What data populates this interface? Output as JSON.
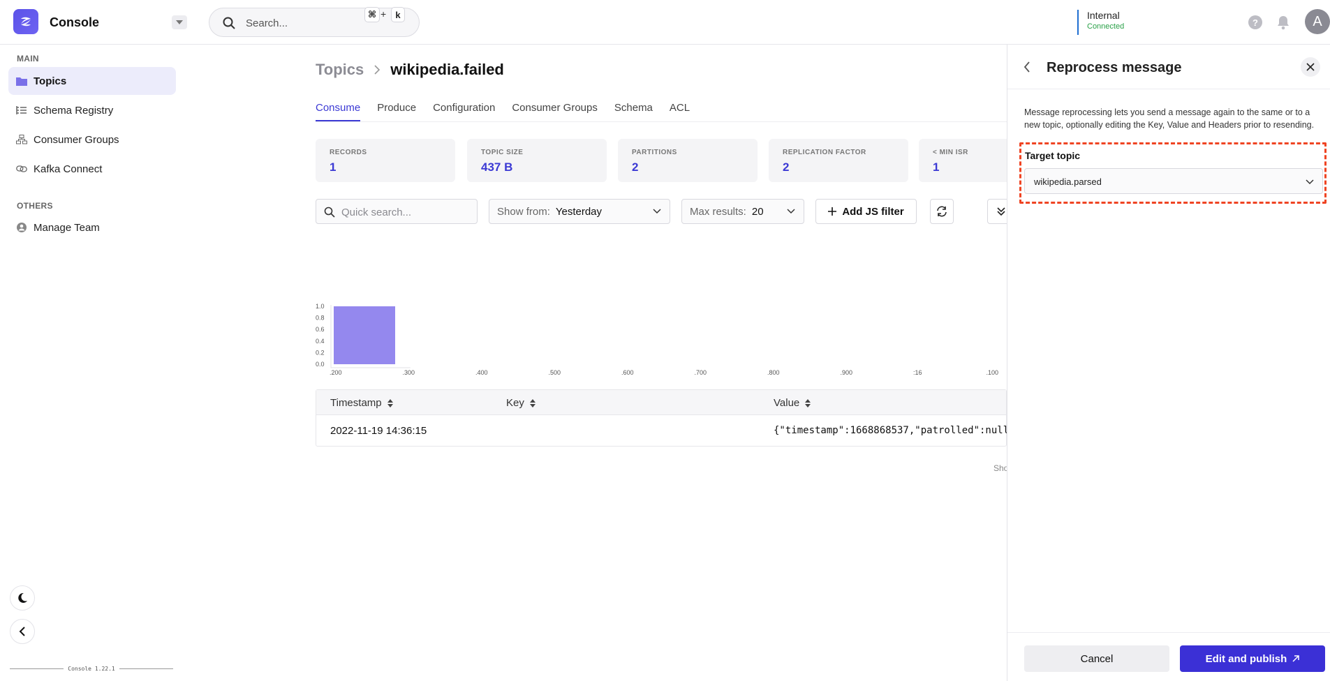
{
  "app": {
    "title": "Console",
    "version": "Console 1.22.1"
  },
  "search": {
    "placeholder": "Search...",
    "shortcut_mod": "⌘",
    "shortcut_plus": "+",
    "shortcut_key": "k"
  },
  "cluster": {
    "name": "Internal",
    "status": "Connected",
    "status_color": "#2aa148"
  },
  "user": {
    "initial": "A"
  },
  "help_glyph": "?",
  "sidebar": {
    "sections": [
      {
        "label": "MAIN",
        "items": [
          {
            "label": "Topics",
            "icon": "folder-icon",
            "active": true
          },
          {
            "label": "Schema Registry",
            "icon": "list-icon"
          },
          {
            "label": "Consumer Groups",
            "icon": "groups-icon"
          },
          {
            "label": "Kafka Connect",
            "icon": "link-icon"
          }
        ]
      },
      {
        "label": "OTHERS",
        "items": [
          {
            "label": "Manage Team",
            "icon": "user-icon"
          }
        ]
      }
    ]
  },
  "breadcrumb": {
    "parent": "Topics",
    "current": "wikipedia.failed"
  },
  "tabs": [
    "Consume",
    "Produce",
    "Configuration",
    "Consumer Groups",
    "Schema",
    "ACL"
  ],
  "active_tab": "Consume",
  "stats": [
    {
      "label": "RECORDS",
      "value": "1"
    },
    {
      "label": "TOPIC SIZE",
      "value": "437 B"
    },
    {
      "label": "PARTITIONS",
      "value": "2"
    },
    {
      "label": "REPLICATION FACTOR",
      "value": "2"
    },
    {
      "label": "< MIN ISR",
      "value": "1"
    }
  ],
  "filters": {
    "quick_search_placeholder": "Quick search...",
    "show_from_label": "Show from:",
    "show_from_value": "Yesterday",
    "max_results_label": "Max results:",
    "max_results_value": "20",
    "add_filter_label": "Add JS filter"
  },
  "chart_data": {
    "type": "bar",
    "categories": [
      ".200",
      ".300",
      ".400",
      ".500",
      ".600",
      ".700",
      ".800",
      ".900",
      ":16",
      ".100"
    ],
    "values": [
      1,
      0,
      0,
      0,
      0,
      0,
      0,
      0,
      0,
      0
    ],
    "y_ticks": [
      "1.0",
      "0.8",
      "0.6",
      "0.4",
      "0.2",
      "0.0"
    ],
    "ylim": [
      0,
      1
    ],
    "bar_color": "#9488ee",
    "title": "",
    "xlabel": "",
    "ylabel": ""
  },
  "table": {
    "columns": [
      "Timestamp",
      "Key",
      "Value"
    ],
    "rows": [
      {
        "timestamp": "2022-11-19 14:36:15",
        "key": "",
        "value": "{\"timestamp\":1668868537,\"patrolled\":null"
      }
    ],
    "footer_text": "Sho"
  },
  "drawer": {
    "title": "Reprocess message",
    "description": "Message reprocessing lets you send a message again to the same or to a new topic, optionally editing the Key, Value and Headers prior to resending.",
    "target_topic_label": "Target topic",
    "target_topic_value": "wikipedia.parsed",
    "cancel_label": "Cancel",
    "publish_label": "Edit and publish",
    "highlight_color": "#ef4423"
  },
  "colors": {
    "accent": "#3b39d4",
    "publish": "#3b30d6"
  }
}
